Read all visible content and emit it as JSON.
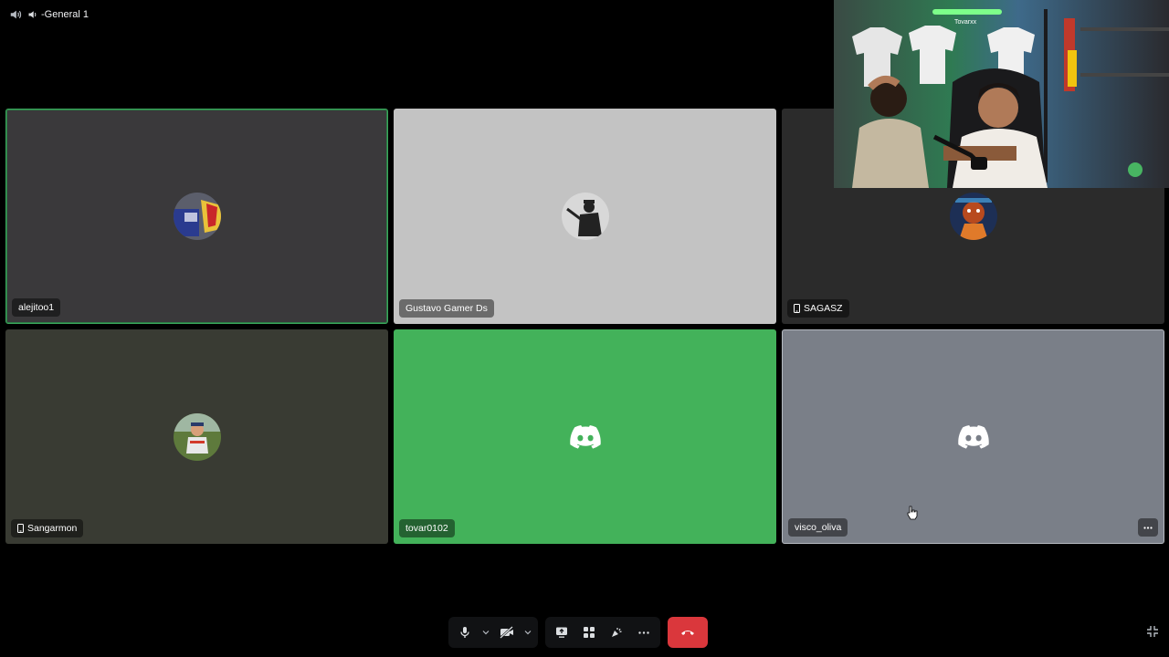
{
  "header": {
    "channel_name": "-General 1",
    "speaker_icon": "speaker-icon",
    "channel_icon": "voice-channel-icon"
  },
  "participants": [
    {
      "name": "alejitoo1",
      "speaking": true,
      "bg": "#3a393b",
      "mobile": false,
      "avatar_colors": [
        "#2a3b8f",
        "#e9c23a"
      ]
    },
    {
      "name": "Gustavo Gamer Ds",
      "speaking": false,
      "bg": "#c3c3c3",
      "mobile": false,
      "avatar_colors": [
        "#d8d8d8",
        "#222222"
      ]
    },
    {
      "name": "SAGASZ",
      "speaking": false,
      "bg": "#2b2b2b",
      "mobile": true,
      "avatar_colors": [
        "#b84a1e",
        "#1d2f55"
      ]
    },
    {
      "name": "Sangarmon",
      "speaking": false,
      "bg": "#393b33",
      "mobile": true,
      "avatar_colors": [
        "#5e7a3c",
        "#e8e8e8"
      ]
    },
    {
      "name": "tovar0102",
      "speaking": false,
      "bg": "#43b25a",
      "mobile": false,
      "avatar": "discord-logo-icon"
    },
    {
      "name": "visco_oliva",
      "speaking": false,
      "bg": "#7a7f88",
      "mobile": false,
      "avatar": "discord-logo-icon",
      "hover": true
    }
  ],
  "stream_overlay": {
    "sign_text": "Tovarxx"
  },
  "controls": {
    "mic_icon": "microphone-icon",
    "camera_icon": "camera-off-icon",
    "screenshare_icon": "screen-share-icon",
    "activities_icon": "activities-icon",
    "soundboard_icon": "soundboard-icon",
    "more_icon": "more-icon",
    "hangup_icon": "hang-up-icon",
    "collapse_icon": "exit-fullscreen-icon"
  },
  "colors": {
    "speaking_border": "#3ba55c",
    "hangup": "#da373c",
    "control_bg": "#111214"
  }
}
